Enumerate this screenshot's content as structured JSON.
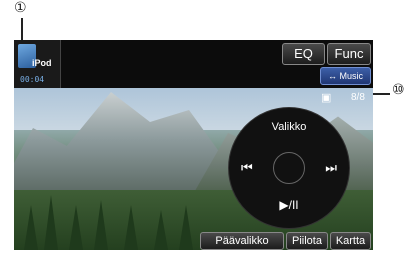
{
  "callouts": {
    "one": "①",
    "ten": "⑩"
  },
  "source": {
    "label": "iPod",
    "time": "00:04"
  },
  "header": {
    "eq_label": "EQ",
    "func_label": "Func",
    "music_label": "↔ Music"
  },
  "track": {
    "icon": "film-icon",
    "count": "8/8"
  },
  "wheel": {
    "menu_label": "Valikko",
    "prev_glyph": "⏮",
    "next_glyph": "⏭",
    "play_glyph": "▶/II"
  },
  "bottom": {
    "main_menu_label": "Päävalikko",
    "hide_label": "Piilota",
    "map_label": "Kartta"
  },
  "colors": {
    "accent": "#3d5fa8",
    "time": "#7ab0e6"
  }
}
